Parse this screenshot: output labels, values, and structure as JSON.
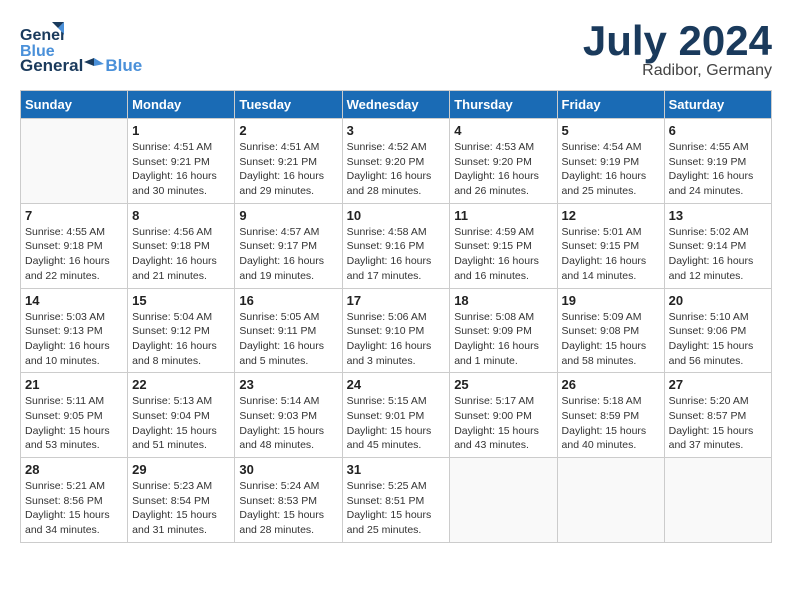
{
  "header": {
    "logo_general": "General",
    "logo_blue": "Blue",
    "month": "July 2024",
    "location": "Radibor, Germany"
  },
  "days_of_week": [
    "Sunday",
    "Monday",
    "Tuesday",
    "Wednesday",
    "Thursday",
    "Friday",
    "Saturday"
  ],
  "weeks": [
    [
      {
        "day": "",
        "info": ""
      },
      {
        "day": "1",
        "info": "Sunrise: 4:51 AM\nSunset: 9:21 PM\nDaylight: 16 hours\nand 30 minutes."
      },
      {
        "day": "2",
        "info": "Sunrise: 4:51 AM\nSunset: 9:21 PM\nDaylight: 16 hours\nand 29 minutes."
      },
      {
        "day": "3",
        "info": "Sunrise: 4:52 AM\nSunset: 9:20 PM\nDaylight: 16 hours\nand 28 minutes."
      },
      {
        "day": "4",
        "info": "Sunrise: 4:53 AM\nSunset: 9:20 PM\nDaylight: 16 hours\nand 26 minutes."
      },
      {
        "day": "5",
        "info": "Sunrise: 4:54 AM\nSunset: 9:19 PM\nDaylight: 16 hours\nand 25 minutes."
      },
      {
        "day": "6",
        "info": "Sunrise: 4:55 AM\nSunset: 9:19 PM\nDaylight: 16 hours\nand 24 minutes."
      }
    ],
    [
      {
        "day": "7",
        "info": "Sunrise: 4:55 AM\nSunset: 9:18 PM\nDaylight: 16 hours\nand 22 minutes."
      },
      {
        "day": "8",
        "info": "Sunrise: 4:56 AM\nSunset: 9:18 PM\nDaylight: 16 hours\nand 21 minutes."
      },
      {
        "day": "9",
        "info": "Sunrise: 4:57 AM\nSunset: 9:17 PM\nDaylight: 16 hours\nand 19 minutes."
      },
      {
        "day": "10",
        "info": "Sunrise: 4:58 AM\nSunset: 9:16 PM\nDaylight: 16 hours\nand 17 minutes."
      },
      {
        "day": "11",
        "info": "Sunrise: 4:59 AM\nSunset: 9:15 PM\nDaylight: 16 hours\nand 16 minutes."
      },
      {
        "day": "12",
        "info": "Sunrise: 5:01 AM\nSunset: 9:15 PM\nDaylight: 16 hours\nand 14 minutes."
      },
      {
        "day": "13",
        "info": "Sunrise: 5:02 AM\nSunset: 9:14 PM\nDaylight: 16 hours\nand 12 minutes."
      }
    ],
    [
      {
        "day": "14",
        "info": "Sunrise: 5:03 AM\nSunset: 9:13 PM\nDaylight: 16 hours\nand 10 minutes."
      },
      {
        "day": "15",
        "info": "Sunrise: 5:04 AM\nSunset: 9:12 PM\nDaylight: 16 hours\nand 8 minutes."
      },
      {
        "day": "16",
        "info": "Sunrise: 5:05 AM\nSunset: 9:11 PM\nDaylight: 16 hours\nand 5 minutes."
      },
      {
        "day": "17",
        "info": "Sunrise: 5:06 AM\nSunset: 9:10 PM\nDaylight: 16 hours\nand 3 minutes."
      },
      {
        "day": "18",
        "info": "Sunrise: 5:08 AM\nSunset: 9:09 PM\nDaylight: 16 hours\nand 1 minute."
      },
      {
        "day": "19",
        "info": "Sunrise: 5:09 AM\nSunset: 9:08 PM\nDaylight: 15 hours\nand 58 minutes."
      },
      {
        "day": "20",
        "info": "Sunrise: 5:10 AM\nSunset: 9:06 PM\nDaylight: 15 hours\nand 56 minutes."
      }
    ],
    [
      {
        "day": "21",
        "info": "Sunrise: 5:11 AM\nSunset: 9:05 PM\nDaylight: 15 hours\nand 53 minutes."
      },
      {
        "day": "22",
        "info": "Sunrise: 5:13 AM\nSunset: 9:04 PM\nDaylight: 15 hours\nand 51 minutes."
      },
      {
        "day": "23",
        "info": "Sunrise: 5:14 AM\nSunset: 9:03 PM\nDaylight: 15 hours\nand 48 minutes."
      },
      {
        "day": "24",
        "info": "Sunrise: 5:15 AM\nSunset: 9:01 PM\nDaylight: 15 hours\nand 45 minutes."
      },
      {
        "day": "25",
        "info": "Sunrise: 5:17 AM\nSunset: 9:00 PM\nDaylight: 15 hours\nand 43 minutes."
      },
      {
        "day": "26",
        "info": "Sunrise: 5:18 AM\nSunset: 8:59 PM\nDaylight: 15 hours\nand 40 minutes."
      },
      {
        "day": "27",
        "info": "Sunrise: 5:20 AM\nSunset: 8:57 PM\nDaylight: 15 hours\nand 37 minutes."
      }
    ],
    [
      {
        "day": "28",
        "info": "Sunrise: 5:21 AM\nSunset: 8:56 PM\nDaylight: 15 hours\nand 34 minutes."
      },
      {
        "day": "29",
        "info": "Sunrise: 5:23 AM\nSunset: 8:54 PM\nDaylight: 15 hours\nand 31 minutes."
      },
      {
        "day": "30",
        "info": "Sunrise: 5:24 AM\nSunset: 8:53 PM\nDaylight: 15 hours\nand 28 minutes."
      },
      {
        "day": "31",
        "info": "Sunrise: 5:25 AM\nSunset: 8:51 PM\nDaylight: 15 hours\nand 25 minutes."
      },
      {
        "day": "",
        "info": ""
      },
      {
        "day": "",
        "info": ""
      },
      {
        "day": "",
        "info": ""
      }
    ]
  ]
}
